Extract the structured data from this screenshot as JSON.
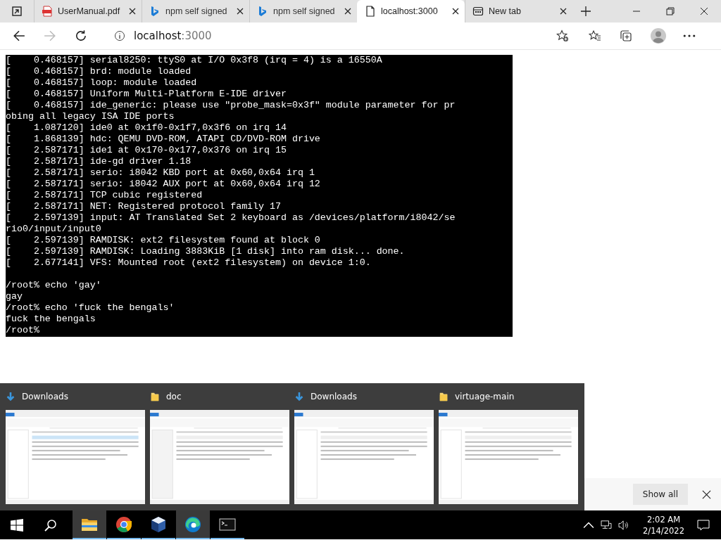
{
  "browser": {
    "tabs": [
      {
        "title": "UserManual.pdf",
        "kind": "pdf",
        "selected": false
      },
      {
        "title": "npm self signed",
        "kind": "bing",
        "selected": false
      },
      {
        "title": "npm self signed",
        "kind": "bing",
        "selected": false
      },
      {
        "title": "localhost:3000",
        "kind": "page",
        "selected": true
      },
      {
        "title": "New tab",
        "kind": "newtab",
        "selected": false
      }
    ],
    "address": {
      "host": "localhost",
      "port": ":3000"
    }
  },
  "terminal": {
    "boot_log": [
      "[    0.468157] serial8250: ttyS0 at I/O 0x3f8 (irq = 4) is a 16550A",
      "[    0.468157] brd: module loaded",
      "[    0.468157] loop: module loaded",
      "[    0.468157] Uniform Multi-Platform E-IDE driver",
      "[    0.468157] ide_generic: please use \"probe_mask=0x3f\" module parameter for pr",
      "obing all legacy ISA IDE ports",
      "[    1.087120] ide0 at 0x1f0-0x1f7,0x3f6 on irq 14",
      "[    1.868139] hdc: QEMU DVD-ROM, ATAPI CD/DVD-ROM drive",
      "[    2.587171] ide1 at 0x170-0x177,0x376 on irq 15",
      "[    2.587171] ide-gd driver 1.18",
      "[    2.587171] serio: i8042 KBD port at 0x60,0x64 irq 1",
      "[    2.587171] serio: i8042 AUX port at 0x60,0x64 irq 12",
      "[    2.587171] TCP cubic registered",
      "[    2.587171] NET: Registered protocol family 17",
      "[    2.597139] input: AT Translated Set 2 keyboard as /devices/platform/i8042/se",
      "rio0/input/input0",
      "[    2.597139] RAMDISK: ext2 filesystem found at block 0",
      "[    2.597139] RAMDISK: Loading 3883KiB [1 disk] into ram disk... done.",
      "[    2.677141] VFS: Mounted root (ext2 filesystem) on device 1:0."
    ],
    "shell": [
      "/root% echo 'gay'",
      "gay",
      "/root% echo 'fuck the bengals'",
      "fuck the bengals",
      "/root%"
    ]
  },
  "window_previews": [
    {
      "title": "Downloads",
      "kind": "downloads"
    },
    {
      "title": "doc",
      "kind": "folder"
    },
    {
      "title": "Downloads",
      "kind": "downloads"
    },
    {
      "title": "virtuage-main",
      "kind": "folder"
    }
  ],
  "download_bar": {
    "button": "Show all"
  },
  "taskbar": {
    "apps": [
      {
        "kind": "explorer",
        "active": true
      },
      {
        "kind": "chrome",
        "active": false
      },
      {
        "kind": "virtualbox",
        "active": false
      },
      {
        "kind": "edge",
        "active": true
      },
      {
        "kind": "terminal",
        "active": false
      }
    ],
    "time": "2:02 AM",
    "date": "2/14/2022"
  }
}
